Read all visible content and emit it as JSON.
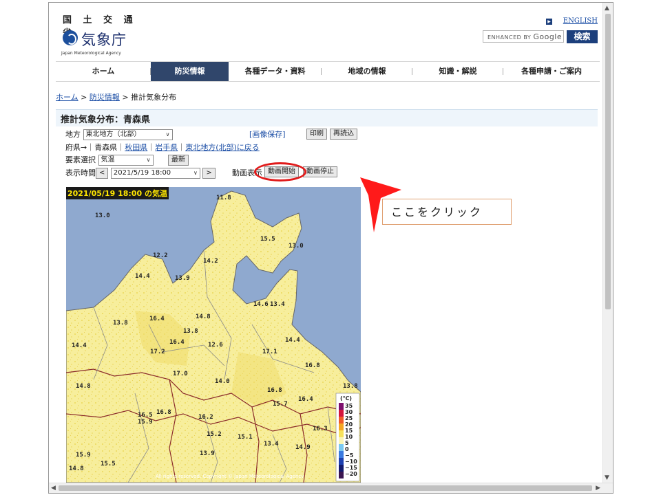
{
  "header": {
    "logo_kanji": "国 土 交 通 省",
    "logo_name": "気象庁",
    "logo_en": "Japan Meteorological Agency",
    "english_link": "ENGLISH",
    "search_prefix": "ENHANCED BY",
    "search_brand": "Google",
    "search_button": "検索"
  },
  "nav": [
    {
      "label": "ホーム"
    },
    {
      "label": "防災情報"
    },
    {
      "label": "各種データ・資料"
    },
    {
      "label": "地域の情報"
    },
    {
      "label": "知識・解説"
    },
    {
      "label": "各種申請・ご案内"
    }
  ],
  "breadcrumb": {
    "home": "ホーム",
    "sep1": " > ",
    "disaster": "防災情報",
    "sep2": " > ",
    "current": "推計気象分布"
  },
  "page_title": "推計気象分布：青森県",
  "controls": {
    "region_label": "地方",
    "region_value": "東北地方（北部）",
    "save_link": "[画像保存]",
    "print_button": "印刷",
    "reload_button": "再読込",
    "prefecture_prefix": "府県→｜",
    "prefecture_current": "青森県",
    "prefecture_sep": "｜",
    "prefecture_akita": "秋田県",
    "prefecture_iwate": "岩手県",
    "prefecture_back": "東北地方(北部)に戻る",
    "element_label": "要素選択",
    "element_value": "気温",
    "latest_button": "最新",
    "time_label": "表示時間",
    "time_prev": "<",
    "time_value": "2021/5/19 18:00",
    "time_next": ">",
    "anim_label": "動画表示",
    "anim_start": "動画開始",
    "anim_stop": "動画停止"
  },
  "map": {
    "title": "2021/05/19 18:00 の気温",
    "copyright": "All rights reserved. Copyright © Japan Meteorological Agency",
    "legend_unit": "(℃)",
    "legend_values": [
      "35",
      "30",
      "25",
      "20",
      "15",
      "10",
      "5",
      "0",
      "−5",
      "−10",
      "−15",
      "−20"
    ],
    "temps": [
      "11.8",
      "13.0",
      "15.5",
      "13.0",
      "12.2",
      "14.2",
      "14.4",
      "13.9",
      "14.6",
      "13.4",
      "16.4",
      "14.8",
      "13.8",
      "13.8",
      "14.4",
      "16.4",
      "12.6",
      "14.4",
      "17.2",
      "17.1",
      "16.8",
      "17.0",
      "14.0",
      "14.8",
      "13.8",
      "16.8",
      "16.4",
      "15.7",
      "16.5",
      "16.8",
      "15.9",
      "16.2",
      "16.3",
      "15.2",
      "15.1",
      "13.4",
      "14.9",
      "15.9",
      "13.9",
      "15.5",
      "14.8"
    ]
  },
  "callout": {
    "text": "ここをクリック"
  },
  "colors": {
    "nav_active": "#30466b",
    "search_button": "#1c3f7c",
    "highlight": "#e01a1a",
    "sea": "#8fa9cf",
    "land": "#f7ee9c"
  }
}
